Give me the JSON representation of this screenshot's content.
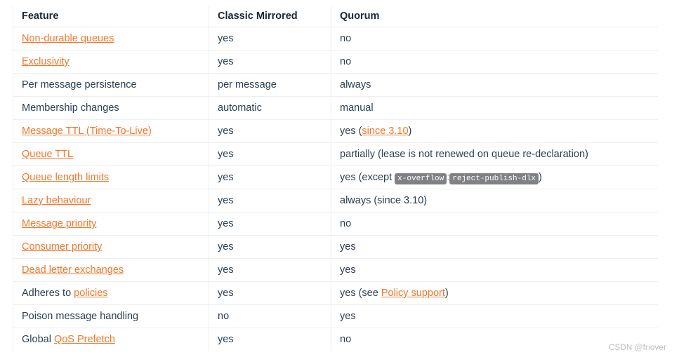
{
  "table": {
    "columns": [
      "Feature",
      "Classic Mirrored",
      "Quorum"
    ],
    "rows": [
      {
        "feature": {
          "text": "Non-durable queues",
          "link": true
        },
        "classic": {
          "text": "yes"
        },
        "quorum": {
          "text": "no"
        }
      },
      {
        "feature": {
          "text": "Exclusivity",
          "link": true
        },
        "classic": {
          "text": "yes"
        },
        "quorum": {
          "text": "no"
        }
      },
      {
        "feature": {
          "text": "Per message persistence",
          "link": false
        },
        "classic": {
          "text": "per message"
        },
        "quorum": {
          "text": "always"
        }
      },
      {
        "feature": {
          "text": "Membership changes",
          "link": false
        },
        "classic": {
          "text": "automatic"
        },
        "quorum": {
          "text": "manual"
        }
      },
      {
        "feature": {
          "text": "Message TTL (Time-To-Live)",
          "link": true
        },
        "classic": {
          "text": "yes"
        },
        "quorum": {
          "prefix": "yes (",
          "link_text": "since 3.10",
          "suffix": ")"
        }
      },
      {
        "feature": {
          "text": "Queue TTL",
          "link": true
        },
        "classic": {
          "text": "yes"
        },
        "quorum": {
          "text": "partially (lease is not renewed on queue re-declaration)"
        }
      },
      {
        "feature": {
          "text": "Queue length limits",
          "link": true
        },
        "classic": {
          "text": "yes"
        },
        "quorum": {
          "prefix": "yes (except ",
          "code_a": "x-overflow",
          "between": ":",
          "code_b": "reject-publish-dlx",
          "suffix": ")"
        }
      },
      {
        "feature": {
          "text": "Lazy behaviour",
          "link": true
        },
        "classic": {
          "text": "yes"
        },
        "quorum": {
          "text": "always (since 3.10)"
        }
      },
      {
        "feature": {
          "text": "Message priority",
          "link": true
        },
        "classic": {
          "text": "yes"
        },
        "quorum": {
          "text": "no"
        }
      },
      {
        "feature": {
          "text": "Consumer priority",
          "link": true
        },
        "classic": {
          "text": "yes"
        },
        "quorum": {
          "text": "yes"
        }
      },
      {
        "feature": {
          "text": "Dead letter exchanges",
          "link": true
        },
        "classic": {
          "text": "yes"
        },
        "quorum": {
          "text": "yes"
        }
      },
      {
        "feature": {
          "prefix": "Adheres to ",
          "link_text": "policies",
          "suffix": ""
        },
        "classic": {
          "text": "yes"
        },
        "quorum": {
          "prefix": "yes (see ",
          "link_text": "Policy support",
          "suffix": ")"
        }
      },
      {
        "feature": {
          "text": "Poison message handling",
          "link": false
        },
        "classic": {
          "text": "no"
        },
        "quorum": {
          "text": "yes"
        }
      },
      {
        "feature": {
          "prefix": "Global ",
          "link_text": "QoS Prefetch",
          "suffix": ""
        },
        "classic": {
          "text": "yes"
        },
        "quorum": {
          "text": "no"
        }
      }
    ]
  },
  "watermark": {
    "text": "CSDN @friover"
  },
  "colors": {
    "link": "#f4762a",
    "border": "#eceef0",
    "text": "#2c3e50",
    "badge_bg": "#7f8184",
    "watermark": "#b9bcc0"
  }
}
